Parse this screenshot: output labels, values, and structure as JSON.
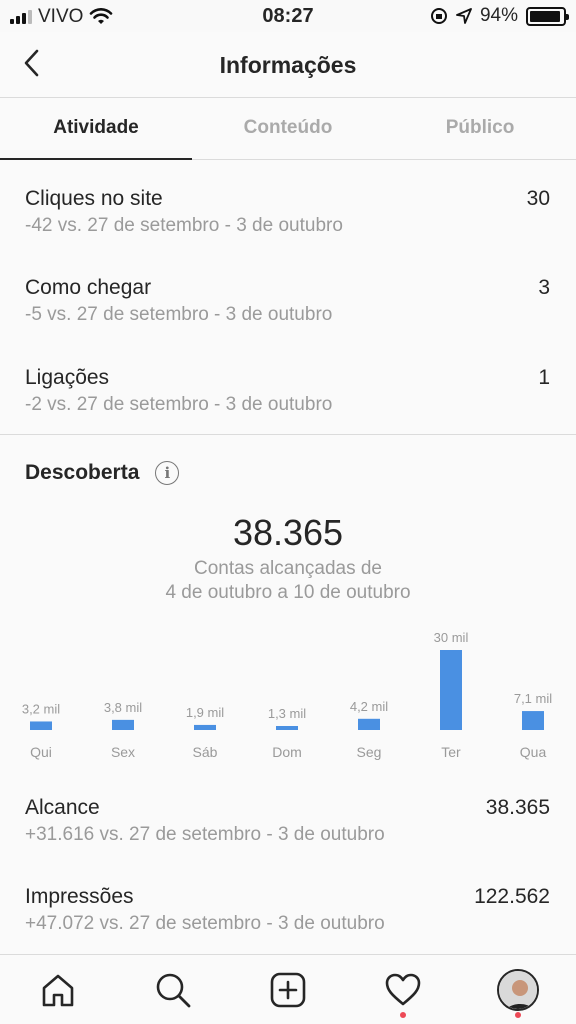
{
  "status_bar": {
    "carrier": "VIVO",
    "time": "08:27",
    "battery": "94%",
    "battery_level": 0.94
  },
  "header": {
    "title": "Informações",
    "back_icon": "chevron-left-icon"
  },
  "tabs": [
    {
      "label": "Atividade",
      "active": true
    },
    {
      "label": "Conteúdo",
      "active": false
    },
    {
      "label": "Público",
      "active": false
    }
  ],
  "interactions": [
    {
      "label": "Cliques no site",
      "change": "-42 vs. 27 de setembro - 3 de outubro",
      "value": "30"
    },
    {
      "label": "Como chegar",
      "change": "-5 vs. 27 de setembro - 3 de outubro",
      "value": "3"
    },
    {
      "label": "Ligações",
      "change": "-2 vs. 27 de setembro - 3 de outubro",
      "value": "1"
    }
  ],
  "discovery": {
    "title": "Descoberta",
    "total": "38.365",
    "caption_line1": "Contas alcançadas de",
    "caption_line2": "4 de outubro a 10 de outubro"
  },
  "chart_data": {
    "type": "bar",
    "categories": [
      "Qui",
      "Sex",
      "Sáb",
      "Dom",
      "Seg",
      "Ter",
      "Qua"
    ],
    "values": [
      3200,
      3800,
      1900,
      1300,
      4200,
      30000,
      7100
    ],
    "data_labels": [
      "3,2 mil",
      "3,8 mil",
      "1,9 mil",
      "1,3 mil",
      "4,2 mil",
      "30 mil",
      "7,1 mil"
    ],
    "bar_color": "#4a90e2",
    "label_color": "#9a9a9a"
  },
  "reach": [
    {
      "label": "Alcance",
      "change": "+31.616 vs. 27 de setembro - 3 de outubro",
      "value": "38.365"
    },
    {
      "label": "Impressões",
      "change": "+47.072 vs. 27 de setembro - 3 de outubro",
      "value": "122.562"
    }
  ],
  "bottom_nav": [
    {
      "icon": "home-icon"
    },
    {
      "icon": "search-icon"
    },
    {
      "icon": "add-post-icon"
    },
    {
      "icon": "heart-icon",
      "notification_dot": true
    },
    {
      "icon": "profile-avatar",
      "notification_dot": true
    }
  ],
  "colors": {
    "accent": "#4a90e2",
    "notification": "#ed4956",
    "muted": "#9a9a9a"
  }
}
